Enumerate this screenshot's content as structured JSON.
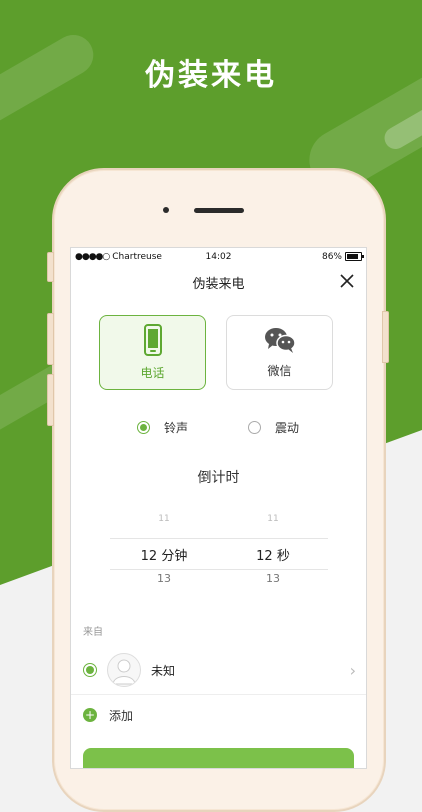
{
  "headline": "伪装来电",
  "status_bar": {
    "carrier": "Chartreuse",
    "time": "14:02",
    "battery": "86%"
  },
  "nav": {
    "title": "伪装来电"
  },
  "call_types": [
    {
      "label": "电话",
      "icon": "phone-icon",
      "selected": true
    },
    {
      "label": "微信",
      "icon": "wechat-icon",
      "selected": false
    }
  ],
  "alert_options": [
    {
      "label": "铃声",
      "selected": true
    },
    {
      "label": "震动",
      "selected": false
    }
  ],
  "countdown": {
    "title": "倒计时",
    "minutes": {
      "prev": "11",
      "value": "12 分钟",
      "next": "13"
    },
    "seconds": {
      "prev": "11",
      "value": "12 秒",
      "next": "13"
    }
  },
  "from": {
    "label": "来自",
    "contact_name": "未知",
    "add_label": "添加"
  },
  "colors": {
    "accent": "#6cb33f",
    "brand_bg": "#5d9e2c"
  }
}
